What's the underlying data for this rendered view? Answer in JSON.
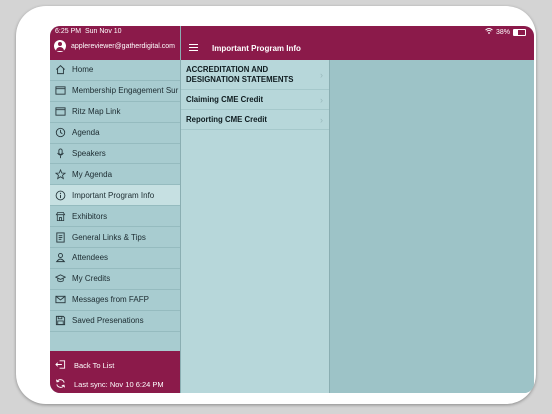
{
  "status_bar": {
    "time": "6:25 PM",
    "date": "Sun Nov 10",
    "battery": "38%"
  },
  "sidebar": {
    "user_email": "applereviewer@gatherdigital.com",
    "items": [
      {
        "label": "Home",
        "icon": "home-icon"
      },
      {
        "label": "Membership Engagement Sur",
        "icon": "window-icon"
      },
      {
        "label": "Ritz Map Link",
        "icon": "window-icon"
      },
      {
        "label": "Agenda",
        "icon": "clock-icon"
      },
      {
        "label": "Speakers",
        "icon": "microphone-icon"
      },
      {
        "label": "My Agenda",
        "icon": "star-icon"
      },
      {
        "label": "Important Program Info",
        "icon": "info-icon",
        "active": true
      },
      {
        "label": "Exhibitors",
        "icon": "booth-icon"
      },
      {
        "label": "General Links & Tips",
        "icon": "document-icon"
      },
      {
        "label": "Attendees",
        "icon": "people-icon"
      },
      {
        "label": "My Credits",
        "icon": "graduation-cap-icon"
      },
      {
        "label": "Messages from FAFP",
        "icon": "envelope-icon"
      },
      {
        "label": "Saved Presenations",
        "icon": "save-icon"
      }
    ],
    "back_label": "Back To List",
    "last_sync": "Last sync:  Nov 10 6:24 PM"
  },
  "panel": {
    "title": "Important Program Info",
    "items": [
      {
        "label": "ACCREDITATION AND DESIGNATION STATEMENTS"
      },
      {
        "label": "Claiming CME Credit"
      },
      {
        "label": "Reporting CME Credit"
      }
    ]
  },
  "colors": {
    "accent": "#8b1a4a",
    "sidebar_bg": "#a8ccd0",
    "content_bg": "#9dc3c7"
  }
}
